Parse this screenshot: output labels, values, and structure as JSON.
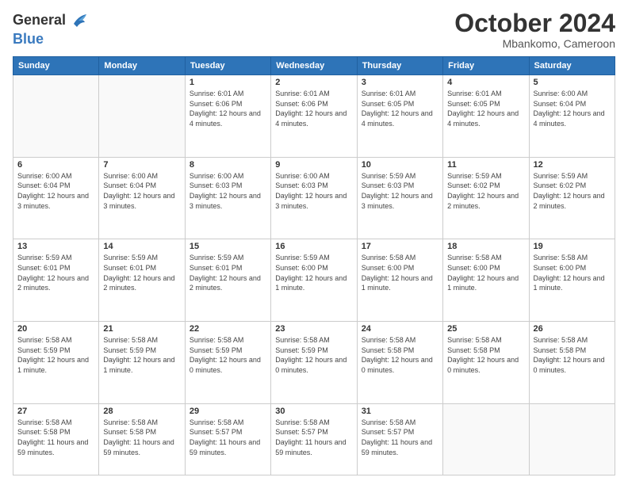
{
  "header": {
    "logo_general": "General",
    "logo_blue": "Blue",
    "month": "October 2024",
    "location": "Mbankomo, Cameroon"
  },
  "days_of_week": [
    "Sunday",
    "Monday",
    "Tuesday",
    "Wednesday",
    "Thursday",
    "Friday",
    "Saturday"
  ],
  "weeks": [
    [
      {
        "day": "",
        "info": ""
      },
      {
        "day": "",
        "info": ""
      },
      {
        "day": "1",
        "info": "Sunrise: 6:01 AM\nSunset: 6:06 PM\nDaylight: 12 hours and 4 minutes."
      },
      {
        "day": "2",
        "info": "Sunrise: 6:01 AM\nSunset: 6:06 PM\nDaylight: 12 hours and 4 minutes."
      },
      {
        "day": "3",
        "info": "Sunrise: 6:01 AM\nSunset: 6:05 PM\nDaylight: 12 hours and 4 minutes."
      },
      {
        "day": "4",
        "info": "Sunrise: 6:01 AM\nSunset: 6:05 PM\nDaylight: 12 hours and 4 minutes."
      },
      {
        "day": "5",
        "info": "Sunrise: 6:00 AM\nSunset: 6:04 PM\nDaylight: 12 hours and 4 minutes."
      }
    ],
    [
      {
        "day": "6",
        "info": "Sunrise: 6:00 AM\nSunset: 6:04 PM\nDaylight: 12 hours and 3 minutes."
      },
      {
        "day": "7",
        "info": "Sunrise: 6:00 AM\nSunset: 6:04 PM\nDaylight: 12 hours and 3 minutes."
      },
      {
        "day": "8",
        "info": "Sunrise: 6:00 AM\nSunset: 6:03 PM\nDaylight: 12 hours and 3 minutes."
      },
      {
        "day": "9",
        "info": "Sunrise: 6:00 AM\nSunset: 6:03 PM\nDaylight: 12 hours and 3 minutes."
      },
      {
        "day": "10",
        "info": "Sunrise: 5:59 AM\nSunset: 6:03 PM\nDaylight: 12 hours and 3 minutes."
      },
      {
        "day": "11",
        "info": "Sunrise: 5:59 AM\nSunset: 6:02 PM\nDaylight: 12 hours and 2 minutes."
      },
      {
        "day": "12",
        "info": "Sunrise: 5:59 AM\nSunset: 6:02 PM\nDaylight: 12 hours and 2 minutes."
      }
    ],
    [
      {
        "day": "13",
        "info": "Sunrise: 5:59 AM\nSunset: 6:01 PM\nDaylight: 12 hours and 2 minutes."
      },
      {
        "day": "14",
        "info": "Sunrise: 5:59 AM\nSunset: 6:01 PM\nDaylight: 12 hours and 2 minutes."
      },
      {
        "day": "15",
        "info": "Sunrise: 5:59 AM\nSunset: 6:01 PM\nDaylight: 12 hours and 2 minutes."
      },
      {
        "day": "16",
        "info": "Sunrise: 5:59 AM\nSunset: 6:00 PM\nDaylight: 12 hours and 1 minute."
      },
      {
        "day": "17",
        "info": "Sunrise: 5:58 AM\nSunset: 6:00 PM\nDaylight: 12 hours and 1 minute."
      },
      {
        "day": "18",
        "info": "Sunrise: 5:58 AM\nSunset: 6:00 PM\nDaylight: 12 hours and 1 minute."
      },
      {
        "day": "19",
        "info": "Sunrise: 5:58 AM\nSunset: 6:00 PM\nDaylight: 12 hours and 1 minute."
      }
    ],
    [
      {
        "day": "20",
        "info": "Sunrise: 5:58 AM\nSunset: 5:59 PM\nDaylight: 12 hours and 1 minute."
      },
      {
        "day": "21",
        "info": "Sunrise: 5:58 AM\nSunset: 5:59 PM\nDaylight: 12 hours and 1 minute."
      },
      {
        "day": "22",
        "info": "Sunrise: 5:58 AM\nSunset: 5:59 PM\nDaylight: 12 hours and 0 minutes."
      },
      {
        "day": "23",
        "info": "Sunrise: 5:58 AM\nSunset: 5:59 PM\nDaylight: 12 hours and 0 minutes."
      },
      {
        "day": "24",
        "info": "Sunrise: 5:58 AM\nSunset: 5:58 PM\nDaylight: 12 hours and 0 minutes."
      },
      {
        "day": "25",
        "info": "Sunrise: 5:58 AM\nSunset: 5:58 PM\nDaylight: 12 hours and 0 minutes."
      },
      {
        "day": "26",
        "info": "Sunrise: 5:58 AM\nSunset: 5:58 PM\nDaylight: 12 hours and 0 minutes."
      }
    ],
    [
      {
        "day": "27",
        "info": "Sunrise: 5:58 AM\nSunset: 5:58 PM\nDaylight: 11 hours and 59 minutes."
      },
      {
        "day": "28",
        "info": "Sunrise: 5:58 AM\nSunset: 5:58 PM\nDaylight: 11 hours and 59 minutes."
      },
      {
        "day": "29",
        "info": "Sunrise: 5:58 AM\nSunset: 5:57 PM\nDaylight: 11 hours and 59 minutes."
      },
      {
        "day": "30",
        "info": "Sunrise: 5:58 AM\nSunset: 5:57 PM\nDaylight: 11 hours and 59 minutes."
      },
      {
        "day": "31",
        "info": "Sunrise: 5:58 AM\nSunset: 5:57 PM\nDaylight: 11 hours and 59 minutes."
      },
      {
        "day": "",
        "info": ""
      },
      {
        "day": "",
        "info": ""
      }
    ]
  ]
}
